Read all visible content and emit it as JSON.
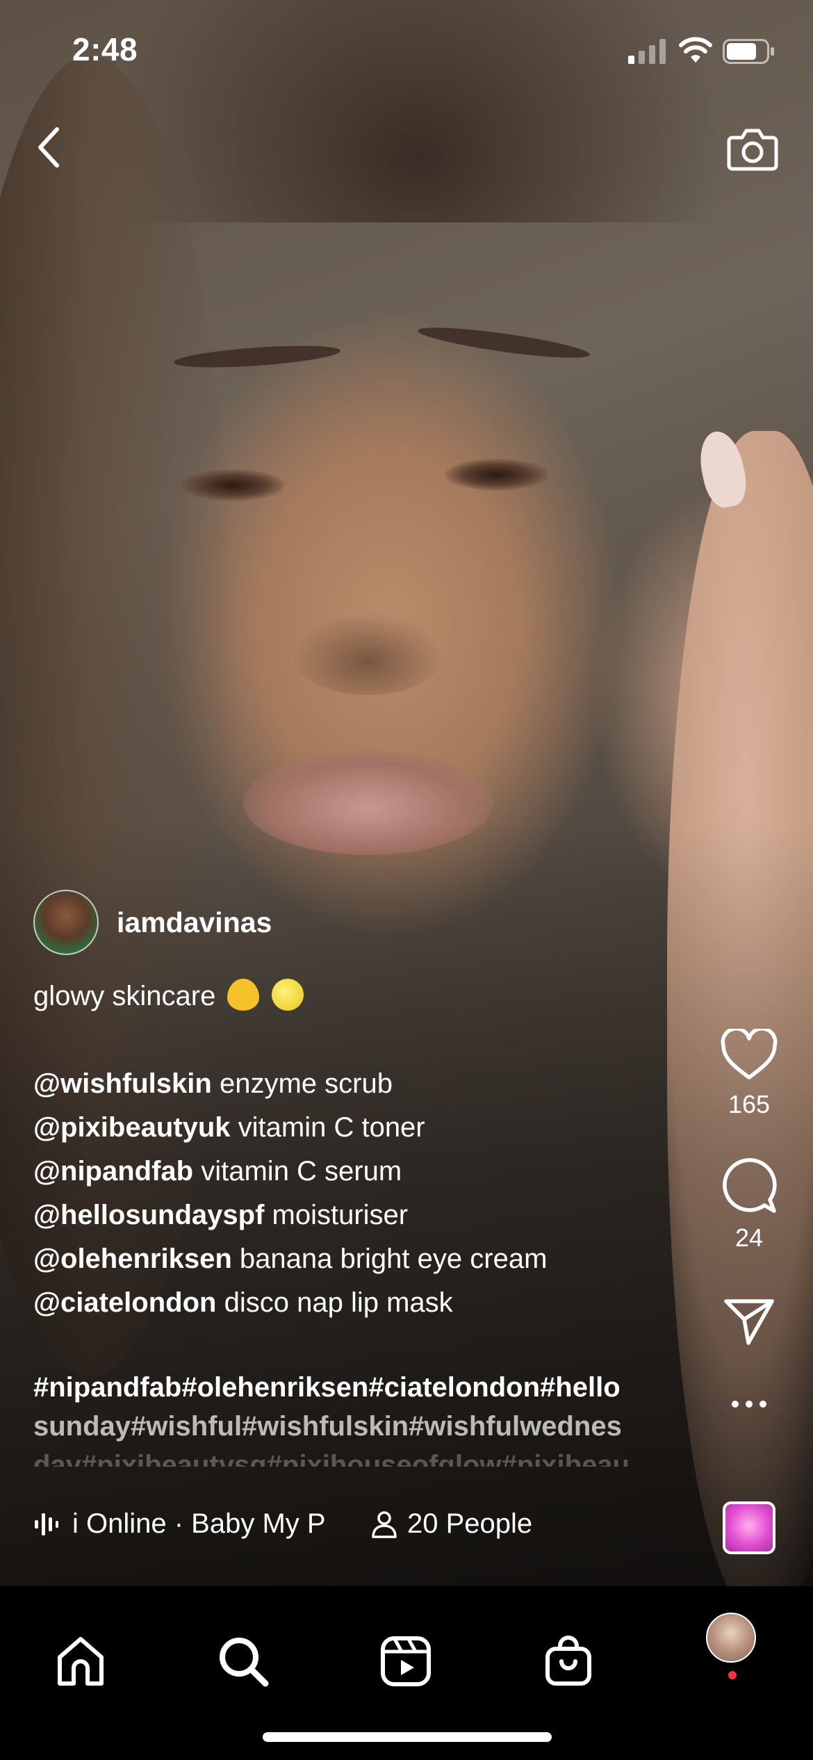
{
  "status_bar": {
    "time": "2:48"
  },
  "post": {
    "username": "iamdavinas",
    "caption_title": "glowy skincare",
    "products": [
      {
        "mention": "@wishfulskin",
        "text": "enzyme scrub"
      },
      {
        "mention": "@pixibeautyuk",
        "text": "vitamin C toner"
      },
      {
        "mention": "@nipandfab",
        "text": "vitamin C serum"
      },
      {
        "mention": "@hellosundayspf",
        "text": "moisturiser"
      },
      {
        "mention": "@olehenriksen",
        "text": "banana bright eye cream"
      },
      {
        "mention": "@ciatelondon",
        "text": "disco nap lip mask"
      }
    ],
    "hashtags": [
      "#nipandfab#olehenriksen#ciatelondon#hello",
      "sunday#wishful#wishfulskin#wishfulwednes",
      "day#pixibeautysg#pixihouseofglow#pixibeau"
    ],
    "audio": "i Online · Baby My P",
    "people": "20 People"
  },
  "actions": {
    "likes": "165",
    "comments": "24"
  },
  "icons": {
    "back": "chevron-left-icon",
    "camera": "camera-icon",
    "like": "heart-icon",
    "comment": "comment-icon",
    "share": "paper-plane-icon",
    "more": "more-icon"
  },
  "colors": {
    "notification_dot": "#ff3040",
    "emoji_heart": "#f5c22b"
  }
}
